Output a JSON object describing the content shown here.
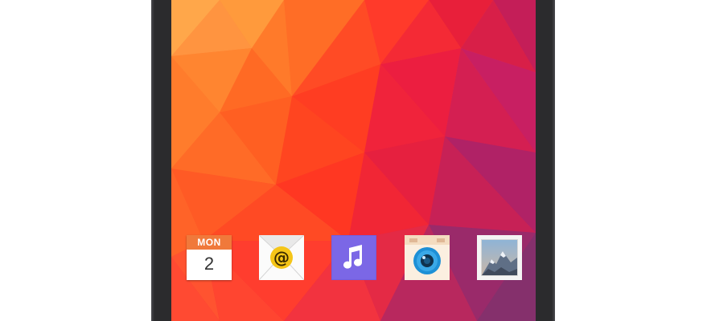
{
  "device": {
    "frame_color": "#2b2b2d"
  },
  "wallpaper": {
    "palette": [
      "#ffa046",
      "#ff8a33",
      "#ff6a22",
      "#ff3d1f",
      "#f4233a",
      "#e01e55",
      "#c81f6a",
      "#a4246f",
      "#7d2c6c"
    ]
  },
  "dock": {
    "apps": [
      {
        "name": "calendar",
        "icon": "calendar-icon",
        "month": "MON",
        "day": "2",
        "accent": "#f0793b"
      },
      {
        "name": "email",
        "icon": "email-icon",
        "symbol": "@",
        "accent": "#f5c518"
      },
      {
        "name": "music",
        "icon": "music-icon",
        "symbol": "♫",
        "accent": "#7b67e6"
      },
      {
        "name": "camera",
        "icon": "camera-icon",
        "accent": "#1e90d6"
      },
      {
        "name": "gallery",
        "icon": "gallery-icon",
        "accent": "#6a8fb5"
      }
    ]
  }
}
